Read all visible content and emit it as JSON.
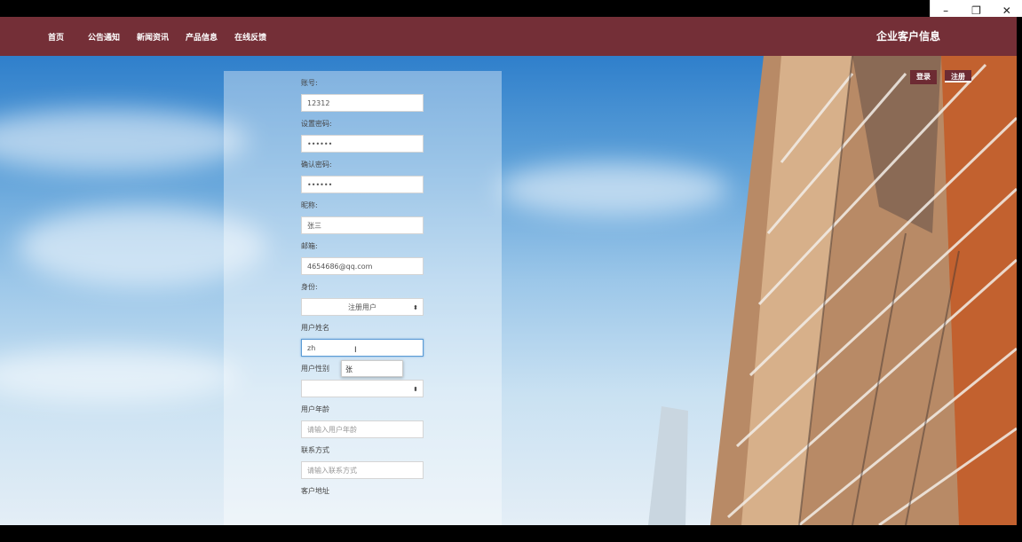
{
  "window_controls": {
    "minimize": "–",
    "maximize": "❐",
    "close": "✕"
  },
  "nav": {
    "items": [
      "首页",
      "公告通知",
      "新闻资讯",
      "产品信息",
      "在线反馈"
    ],
    "site_title": "企业客户信息"
  },
  "auth": {
    "login": "登录",
    "register": "注册"
  },
  "form": {
    "account_label": "账号:",
    "account_value": "12312",
    "password_label": "设置密码:",
    "password_value": "••••••",
    "confirm_label": "确认密码:",
    "confirm_value": "••••••",
    "nickname_label": "昵称:",
    "nickname_value": "张三",
    "email_label": "邮箱:",
    "email_value": "4654686@qq.com",
    "identity_label": "身份:",
    "identity_value": "注册用户",
    "name_label": "用户姓名",
    "name_value": "zh",
    "ime_candidate": "张",
    "gender_label": "用户性别",
    "gender_value": "",
    "age_label": "用户年龄",
    "age_placeholder": "请输入用户年龄",
    "contact_label": "联系方式",
    "contact_placeholder": "请输入联系方式",
    "address_label": "客户地址"
  },
  "colors": {
    "nav_bg": "#742f37",
    "button_bg": "#6d2b33"
  }
}
